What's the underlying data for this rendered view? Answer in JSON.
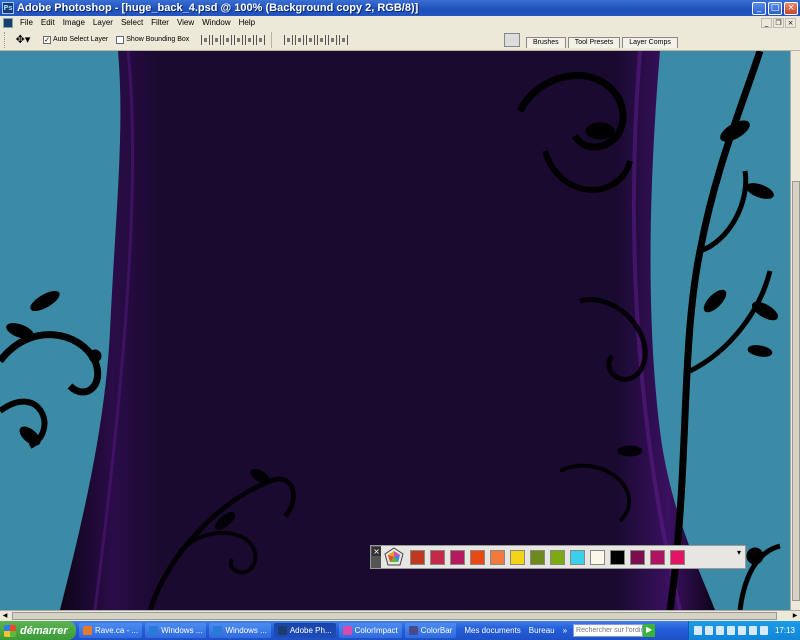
{
  "window": {
    "title": "Adobe Photoshop - [huge_back_4.psd @ 100% (Background copy 2, RGB/8)]",
    "app_icon": "Ps",
    "minimize": "_",
    "maximize": "□",
    "close": "×"
  },
  "menubar": {
    "items": [
      "File",
      "Edit",
      "Image",
      "Layer",
      "Select",
      "Filter",
      "View",
      "Window",
      "Help"
    ],
    "doc_minimize": "_",
    "doc_restore": "❐",
    "doc_close": "×"
  },
  "options": {
    "tool_icon": "move-tool-icon",
    "auto_select_label": "Auto Select Layer",
    "auto_select_checked": true,
    "bounding_box_label": "Show Bounding Box",
    "bounding_box_checked": false,
    "palette_tabs": [
      "Brushes",
      "Tool Presets",
      "Layer Comps"
    ]
  },
  "colorbar": {
    "close": "×",
    "menu": "▾",
    "swatches": [
      "#c0391e",
      "#c42a48",
      "#b51a5c",
      "#e84a14",
      "#f07a3c",
      "#f4d417",
      "#6f8a1c",
      "#7caa10",
      "#3ad0ec",
      "#fbf7ea",
      "#000000",
      "#7a0e4e",
      "#ae1462",
      "#e41464"
    ]
  },
  "colors": {
    "canvas_teal": "#3b8aa6",
    "curtain": "#1a0a30",
    "curtain_edge": "#5a1a86"
  },
  "taskbar": {
    "start_label": "démarrer",
    "tasks": [
      {
        "label": "Rave.ca - ...",
        "icon": "#e8782a",
        "active": false
      },
      {
        "label": "Windows ...",
        "icon": "#2a7ad8",
        "active": false
      },
      {
        "label": "Windows ...",
        "icon": "#2a7ad8",
        "active": false
      },
      {
        "label": "Adobe Ph...",
        "icon": "#1b3c6e",
        "active": true
      },
      {
        "label": "ColorImpact",
        "icon": "#d84ab0",
        "active": false
      },
      {
        "label": "ColorBar",
        "icon": "#4a4a8a",
        "active": false
      }
    ],
    "documents_label": "Mes documents",
    "desktop_label": "Bureau",
    "search_placeholder": "Rechercher sur l'ordin",
    "clock": "17:13"
  }
}
